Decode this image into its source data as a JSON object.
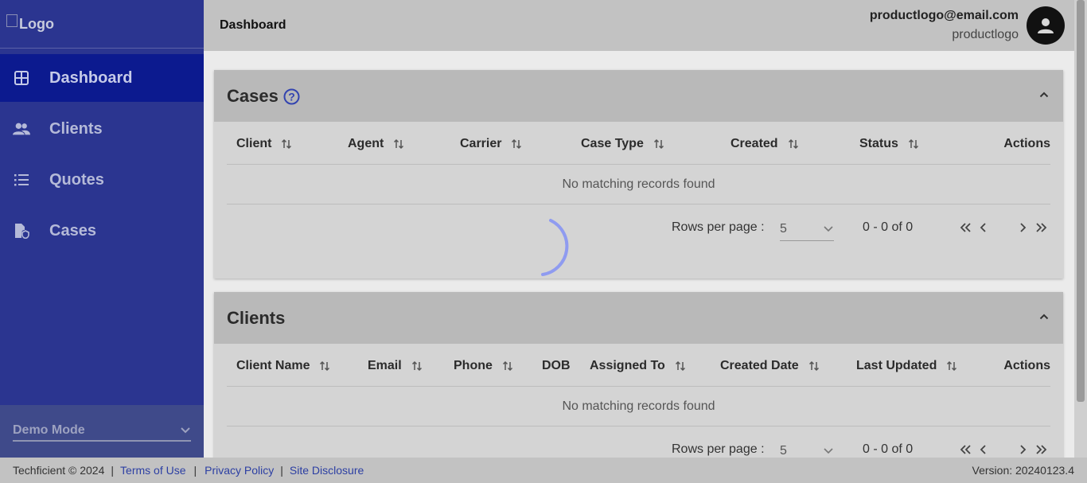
{
  "logo": {
    "alt": "Logo"
  },
  "nav": [
    {
      "label": "Dashboard",
      "icon": "grid-icon",
      "active": true
    },
    {
      "label": "Clients",
      "icon": "people-icon"
    },
    {
      "label": "Quotes",
      "icon": "list-icon"
    },
    {
      "label": "Cases",
      "icon": "case-file-icon"
    }
  ],
  "demo": {
    "label": "Demo Mode"
  },
  "header": {
    "title": "Dashboard",
    "email": "productlogo@email.com",
    "username": "productlogo"
  },
  "cases": {
    "title": "Cases",
    "columns": [
      "Client",
      "Agent",
      "Carrier",
      "Case Type",
      "Created",
      "Status",
      "Actions"
    ],
    "empty": "No matching records found",
    "rows_label": "Rows per page :",
    "rows_value": "5",
    "range": "0 - 0 of 0"
  },
  "clients": {
    "title": "Clients",
    "columns": [
      "Client Name",
      "Email",
      "Phone",
      "DOB",
      "Assigned To",
      "Created Date",
      "Last Updated",
      "Actions"
    ],
    "empty": "No matching records found",
    "rows_label": "Rows per page :",
    "rows_value": "5",
    "range": "0 - 0 of 0"
  },
  "footer": {
    "copyright": "Techficient © 2024",
    "links": [
      "Terms of Use",
      "Privacy Policy",
      "Site Disclosure"
    ],
    "version": "Version: 20240123.4"
  },
  "colors": {
    "sidebar": "#2b3590",
    "active": "#0c1a8f",
    "link": "#2c3fa3",
    "spinner": "#8f9bf0"
  }
}
